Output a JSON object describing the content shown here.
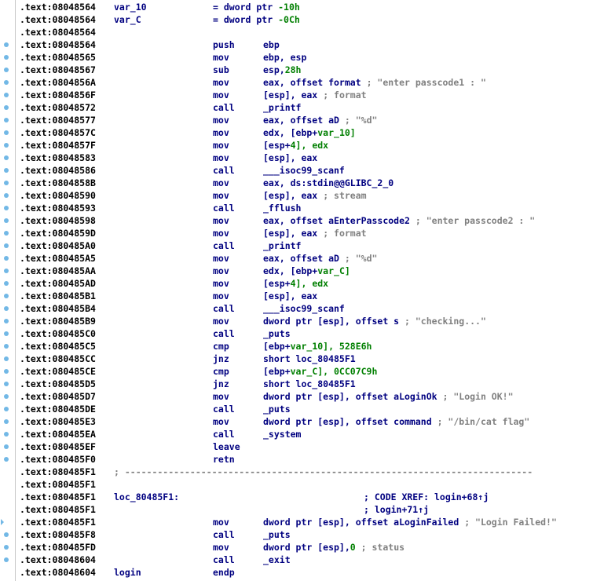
{
  "lines": [
    {
      "addr": ".text:08048564",
      "label": "var_10",
      "mnem": "",
      "op1": "= dword ptr",
      "op2": "-10h",
      "comment": "",
      "dot": false
    },
    {
      "addr": ".text:08048564",
      "label": "var_C",
      "mnem": "",
      "op1": "= dword ptr",
      "op2": "-0Ch",
      "comment": "",
      "dot": false
    },
    {
      "addr": ".text:08048564",
      "label": "",
      "mnem": "",
      "op1": "",
      "op2": "",
      "comment": "",
      "dot": false
    },
    {
      "addr": ".text:08048564",
      "label": "",
      "mnem": "push",
      "op1": "ebp",
      "op2": "",
      "comment": "",
      "dot": true
    },
    {
      "addr": ".text:08048565",
      "label": "",
      "mnem": "mov",
      "op1": "ebp, esp",
      "op2": "",
      "comment": "",
      "dot": true
    },
    {
      "addr": ".text:08048567",
      "label": "",
      "mnem": "sub",
      "op1": "esp,",
      "op2": "28h",
      "comment": "",
      "dot": true
    },
    {
      "addr": ".text:0804856A",
      "label": "",
      "mnem": "mov",
      "op1": "eax, offset format",
      "op2": "",
      "comment": "; \"enter passcode1 : \"",
      "dot": true
    },
    {
      "addr": ".text:0804856F",
      "label": "",
      "mnem": "mov",
      "op1": "[esp], eax",
      "op2": "",
      "comment": "; format",
      "dot": true
    },
    {
      "addr": ".text:08048572",
      "label": "",
      "mnem": "call",
      "op1": "_printf",
      "op2": "",
      "comment": "",
      "dot": true
    },
    {
      "addr": ".text:08048577",
      "label": "",
      "mnem": "mov",
      "op1": "eax, offset aD",
      "op2": "",
      "comment": "; \"%d\"",
      "dot": true
    },
    {
      "addr": ".text:0804857C",
      "label": "",
      "mnem": "mov",
      "op1": "edx, [ebp+",
      "op2": "var_10]",
      "comment": "",
      "dot": true
    },
    {
      "addr": ".text:0804857F",
      "label": "",
      "mnem": "mov",
      "op1": "[esp+",
      "op2": "4], edx",
      "comment": "",
      "dot": true
    },
    {
      "addr": ".text:08048583",
      "label": "",
      "mnem": "mov",
      "op1": "[esp], eax",
      "op2": "",
      "comment": "",
      "dot": true
    },
    {
      "addr": ".text:08048586",
      "label": "",
      "mnem": "call",
      "op1": "___isoc99_scanf",
      "op2": "",
      "comment": "",
      "dot": true
    },
    {
      "addr": ".text:0804858B",
      "label": "",
      "mnem": "mov",
      "op1": "eax, ds:stdin@@GLIBC_2_0",
      "op2": "",
      "comment": "",
      "dot": true
    },
    {
      "addr": ".text:08048590",
      "label": "",
      "mnem": "mov",
      "op1": "[esp], eax",
      "op2": "",
      "comment": "; stream",
      "dot": true
    },
    {
      "addr": ".text:08048593",
      "label": "",
      "mnem": "call",
      "op1": "_fflush",
      "op2": "",
      "comment": "",
      "dot": true
    },
    {
      "addr": ".text:08048598",
      "label": "",
      "mnem": "mov",
      "op1": "eax, offset aEnterPasscode2",
      "op2": "",
      "comment": "; \"enter passcode2 : \"",
      "dot": true
    },
    {
      "addr": ".text:0804859D",
      "label": "",
      "mnem": "mov",
      "op1": "[esp], eax",
      "op2": "",
      "comment": "; format",
      "dot": true
    },
    {
      "addr": ".text:080485A0",
      "label": "",
      "mnem": "call",
      "op1": "_printf",
      "op2": "",
      "comment": "",
      "dot": true
    },
    {
      "addr": ".text:080485A5",
      "label": "",
      "mnem": "mov",
      "op1": "eax, offset aD",
      "op2": "",
      "comment": "; \"%d\"",
      "dot": true
    },
    {
      "addr": ".text:080485AA",
      "label": "",
      "mnem": "mov",
      "op1": "edx, [ebp+",
      "op2": "var_C]",
      "comment": "",
      "dot": true
    },
    {
      "addr": ".text:080485AD",
      "label": "",
      "mnem": "mov",
      "op1": "[esp+",
      "op2": "4], edx",
      "comment": "",
      "dot": true
    },
    {
      "addr": ".text:080485B1",
      "label": "",
      "mnem": "mov",
      "op1": "[esp], eax",
      "op2": "",
      "comment": "",
      "dot": true
    },
    {
      "addr": ".text:080485B4",
      "label": "",
      "mnem": "call",
      "op1": "___isoc99_scanf",
      "op2": "",
      "comment": "",
      "dot": true
    },
    {
      "addr": ".text:080485B9",
      "label": "",
      "mnem": "mov",
      "op1": "dword ptr [esp], offset s",
      "op2": "",
      "comment": "; \"checking...\"",
      "dot": true
    },
    {
      "addr": ".text:080485C0",
      "label": "",
      "mnem": "call",
      "op1": "_puts",
      "op2": "",
      "comment": "",
      "dot": true
    },
    {
      "addr": ".text:080485C5",
      "label": "",
      "mnem": "cmp",
      "op1": "[ebp+",
      "op2": "var_10], 528E6h",
      "comment": "",
      "dot": true
    },
    {
      "addr": ".text:080485CC",
      "label": "",
      "mnem": "jnz",
      "op1": "short loc_80485F1",
      "op2": "",
      "comment": "",
      "dot": true
    },
    {
      "addr": ".text:080485CE",
      "label": "",
      "mnem": "cmp",
      "op1": "[ebp+",
      "op2": "var_C], 0CC07C9h",
      "comment": "",
      "dot": true
    },
    {
      "addr": ".text:080485D5",
      "label": "",
      "mnem": "jnz",
      "op1": "short loc_80485F1",
      "op2": "",
      "comment": "",
      "dot": true
    },
    {
      "addr": ".text:080485D7",
      "label": "",
      "mnem": "mov",
      "op1": "dword ptr [esp], offset aLoginOk",
      "op2": "",
      "comment": "; \"Login OK!\"",
      "dot": true
    },
    {
      "addr": ".text:080485DE",
      "label": "",
      "mnem": "call",
      "op1": "_puts",
      "op2": "",
      "comment": "",
      "dot": true
    },
    {
      "addr": ".text:080485E3",
      "label": "",
      "mnem": "mov",
      "op1": "dword ptr [esp], offset command",
      "op2": "",
      "comment": "; \"/bin/cat flag\"",
      "dot": true
    },
    {
      "addr": ".text:080485EA",
      "label": "",
      "mnem": "call",
      "op1": "_system",
      "op2": "",
      "comment": "",
      "dot": true
    },
    {
      "addr": ".text:080485EF",
      "label": "",
      "mnem": "leave",
      "op1": "",
      "op2": "",
      "comment": "",
      "dot": true
    },
    {
      "addr": ".text:080485F0",
      "label": "",
      "mnem": "retn",
      "op1": "",
      "op2": "",
      "comment": "",
      "dot": true
    },
    {
      "addr": ".text:080485F1",
      "label": "",
      "mnem": "",
      "op1": "",
      "op2": "",
      "comment": "; ---------------------------------------------------------------------------",
      "dot": false,
      "separator": true
    },
    {
      "addr": ".text:080485F1",
      "label": "",
      "mnem": "",
      "op1": "",
      "op2": "",
      "comment": "",
      "dot": false
    },
    {
      "addr": ".text:080485F1",
      "label": "loc_80485F1:",
      "mnem": "",
      "op1": "",
      "op2": "",
      "xref": "; CODE XREF: login+68↑j",
      "dot": false
    },
    {
      "addr": ".text:080485F1",
      "label": "",
      "mnem": "",
      "op1": "",
      "op2": "",
      "xref": "; login+71↑j",
      "dot": false
    },
    {
      "addr": ".text:080485F1",
      "label": "",
      "mnem": "mov",
      "op1": "dword ptr [esp], offset aLoginFailed",
      "op2": "",
      "comment": "; \"Login Failed!\"",
      "dot": true,
      "arrow": true
    },
    {
      "addr": ".text:080485F8",
      "label": "",
      "mnem": "call",
      "op1": "_puts",
      "op2": "",
      "comment": "",
      "dot": true
    },
    {
      "addr": ".text:080485FD",
      "label": "",
      "mnem": "mov",
      "op1": "dword ptr [esp],",
      "op2": "0",
      "comment": "; status",
      "dot": true
    },
    {
      "addr": ".text:08048604",
      "label": "",
      "mnem": "call",
      "op1": "_exit",
      "op2": "",
      "comment": "",
      "dot": true
    },
    {
      "addr": ".text:08048604",
      "label": "login",
      "mnem": "endp",
      "op1": "",
      "op2": "",
      "comment": "",
      "dot": false
    }
  ]
}
